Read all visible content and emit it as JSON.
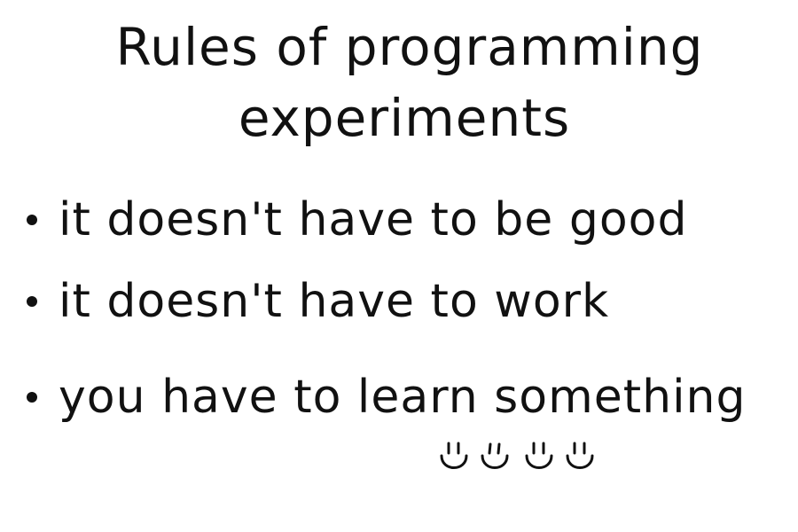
{
  "title": {
    "line1": "Rules of programming",
    "line2": "experiments"
  },
  "rules": [
    {
      "text": "it doesn't have to be good"
    },
    {
      "text": "it doesn't have to work"
    },
    {
      "text": "you have to learn something"
    }
  ],
  "decorations": {
    "smiley_count": 4,
    "icon": "smiley-face-icon"
  }
}
